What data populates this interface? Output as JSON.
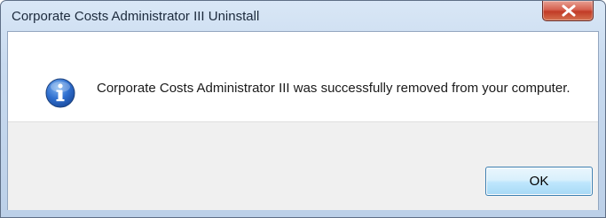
{
  "window": {
    "title": "Corporate Costs Administrator III Uninstall",
    "close_icon": "close-icon"
  },
  "dialog": {
    "icon": "info-icon",
    "message": "Corporate Costs Administrator III was successfully removed from your computer.",
    "ok_label": "OK"
  },
  "colors": {
    "titlebar": "#c8daef",
    "close_button": "#c23b26",
    "footer": "#f0f0f0",
    "ok_border": "#3c7fb1"
  }
}
